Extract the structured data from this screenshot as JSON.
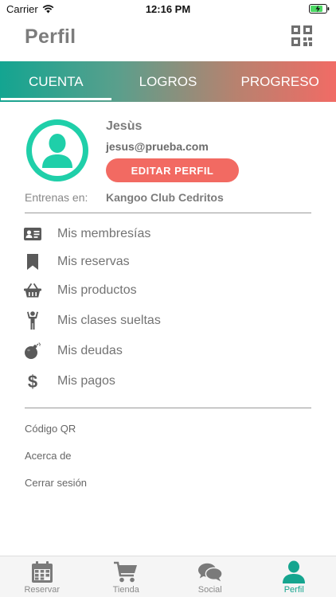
{
  "status_bar": {
    "carrier": "Carrier",
    "time": "12:16 PM"
  },
  "header": {
    "title": "Perfil",
    "qr_icon": "qr-code-icon"
  },
  "tabs": [
    {
      "label": "CUENTA",
      "active": true
    },
    {
      "label": "LOGROS",
      "active": false
    },
    {
      "label": "PROGRESO",
      "active": false
    }
  ],
  "profile": {
    "name": "Jesùs",
    "email": "jesus@prueba.com",
    "edit_label": "EDITAR PERFIL",
    "trains_label": "Entrenas en:",
    "trains_value": "Kangoo Club Cedritos",
    "avatar_icon": "user-avatar-icon"
  },
  "menu": [
    {
      "label": "Mis membresías",
      "icon": "id-card-icon"
    },
    {
      "label": "Mis reservas",
      "icon": "bookmark-icon"
    },
    {
      "label": "Mis productos",
      "icon": "basket-icon"
    },
    {
      "label": "Mis clases sueltas",
      "icon": "person-arms-up-icon"
    },
    {
      "label": "Mis deudas",
      "icon": "bomb-icon"
    },
    {
      "label": "Mis pagos",
      "icon": "dollar-icon"
    }
  ],
  "links": [
    {
      "label": "Código QR"
    },
    {
      "label": "Acerca de"
    },
    {
      "label": "Cerrar sesión"
    }
  ],
  "bottom_nav": [
    {
      "label": "Reservar",
      "icon": "calendar-icon",
      "active": false
    },
    {
      "label": "Tienda",
      "icon": "cart-icon",
      "active": false
    },
    {
      "label": "Social",
      "icon": "chat-bubbles-icon",
      "active": false
    },
    {
      "label": "Perfil",
      "icon": "user-icon",
      "active": true
    }
  ],
  "colors": {
    "accent_green": "#15a58f",
    "accent_coral": "#f26a62",
    "avatar_ring": "#1fcfa9",
    "icon_gray": "#5a5a5a"
  }
}
